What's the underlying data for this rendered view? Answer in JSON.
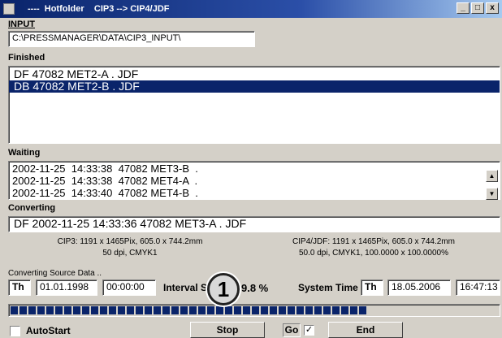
{
  "window": {
    "title": "----  Hotfolder    CIP3 --> CIP4/JDF",
    "minimize": "_",
    "maximize": "□",
    "close": "x"
  },
  "input": {
    "label": "INPUT",
    "path": "C:\\PRESSMANAGER\\DATA\\CIP3_INPUT\\"
  },
  "finished": {
    "label": "Finished",
    "items": [
      "DF 47082 MET2-A . JDF",
      "DB 47082 MET2-B . JDF"
    ]
  },
  "waiting": {
    "label": "Waiting",
    "items": [
      "2002-11-25  14:33:38  47082 MET3-B  .",
      "2002-11-25  14:33:38  47082 MET4-A  .",
      "2002-11-25  14:33:40  47082 MET4-B  ."
    ]
  },
  "converting": {
    "label": "Converting",
    "current": "DF 2002-11-25 14:33:36 47082 MET3-A . JDF",
    "cip3_info_line1": "CIP3: 1191 x 1465Pix, 605.0 x 744.2mm",
    "cip3_info_line2": "50 dpi, CMYK1",
    "cip4_info_line1": "CIP4/JDF: 1191 x 1465Pix, 605.0 x 744.2mm",
    "cip4_info_line2": "50.0 dpi, CMYK1, 100.0000 x 100.0000%",
    "status": "Converting Source Data .."
  },
  "timing": {
    "day1": "Th",
    "date1": "01.01.1998",
    "time1": "00:00:00",
    "interval_label": "Interval S",
    "percent": "9.8 %",
    "system_time_label": "System Time",
    "day2": "Th",
    "date2": "18.05.2006",
    "time2": "16:47:13"
  },
  "progress": {
    "segments": 40
  },
  "controls": {
    "autostart_label": "AutoStart",
    "stop_label": "Stop",
    "go_label": "Go",
    "go_checked": "✓",
    "end_label": "End"
  },
  "callout": {
    "number": "1"
  }
}
